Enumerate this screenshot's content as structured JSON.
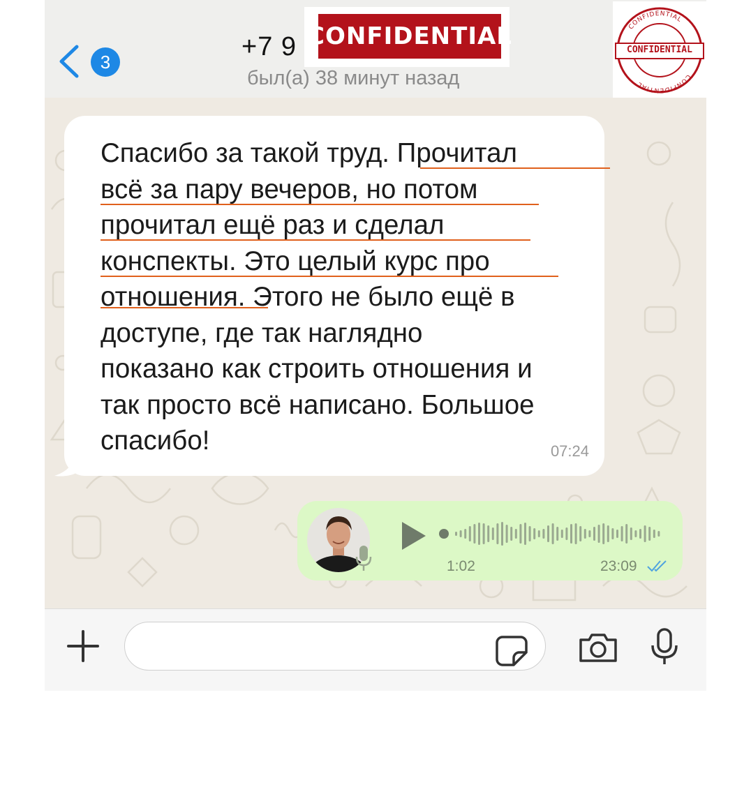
{
  "header": {
    "back_badge": "3",
    "title": "+7 9",
    "status": "был(а) 38 минут назад",
    "stamp_label": "CONFIDENTIAL",
    "round_stamp_label": "CONFIDENTIAL"
  },
  "messages": {
    "incoming": {
      "line1": "Спасибо за такой труд. Прочитал",
      "line2": "всё за пару вечеров, но потом",
      "line3": "прочитал ещё раз и сделал",
      "line4": "конспекты. Это целый курс про",
      "line5": "отношения. Этого не было ещё в",
      "line6": "доступе, где так наглядно",
      "line7": "показано как строить отношения и",
      "line8": "так просто всё написано. Большое",
      "line9": "спасибо!",
      "time": "07:24"
    },
    "outgoing_voice": {
      "duration": "1:02",
      "time": "23:09",
      "status": "read"
    }
  },
  "composer": {
    "placeholder": ""
  },
  "colors": {
    "accent": "#1e88e5",
    "outgoing_bubble": "#dcf8c6",
    "underline": "#e0601c",
    "stamp_red": "#b3121b"
  },
  "icons": [
    "back-chevron-icon",
    "play-icon",
    "microphone-icon",
    "plus-icon",
    "sticker-icon",
    "camera-icon",
    "read-ticks-icon"
  ]
}
